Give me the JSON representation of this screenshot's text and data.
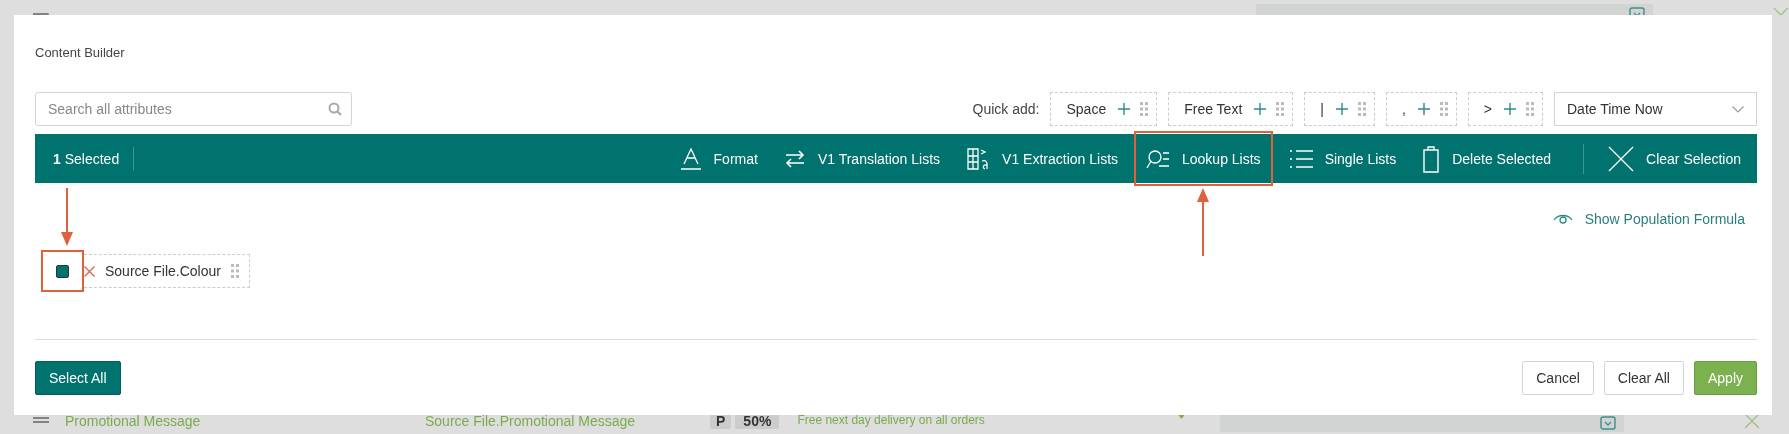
{
  "background_rows": [
    {
      "name": "Promotional Message",
      "source": "Source File.Promotional Message",
      "flag": "P",
      "percent": "50%",
      "value": "Free next day delivery on all orders"
    }
  ],
  "modal": {
    "title": "Content Builder",
    "search": {
      "placeholder": "Search all attributes"
    },
    "quick_add": {
      "label": "Quick add:",
      "items": [
        "Space",
        "Free Text",
        "|",
        ",",
        ">"
      ],
      "dropdown": "Date Time Now"
    },
    "toolbar": {
      "selected_count": "**1** Selected",
      "actions": [
        {
          "kind": "format",
          "label": "Format",
          "highlighted": false
        },
        {
          "kind": "translate",
          "label": "V1 Translation Lists",
          "highlighted": false
        },
        {
          "kind": "extract",
          "label": "V1 Extraction Lists",
          "highlighted": false
        },
        {
          "kind": "lookup",
          "label": "Lookup Lists",
          "highlighted": true
        },
        {
          "kind": "list",
          "label": "Single Lists",
          "highlighted": false
        },
        {
          "kind": "delete",
          "label": "Delete Selected",
          "highlighted": false
        },
        {
          "kind": "clear",
          "label": "Clear Selection",
          "highlighted": false
        }
      ]
    },
    "formula_link": "Show Population Formula",
    "tokens": [
      {
        "label": "Source File.Colour",
        "checked": true,
        "highlighted": true
      }
    ],
    "buttons": {
      "select_all": "Select All",
      "cancel": "Cancel",
      "clear_all": "Clear All",
      "apply": "Apply"
    }
  }
}
